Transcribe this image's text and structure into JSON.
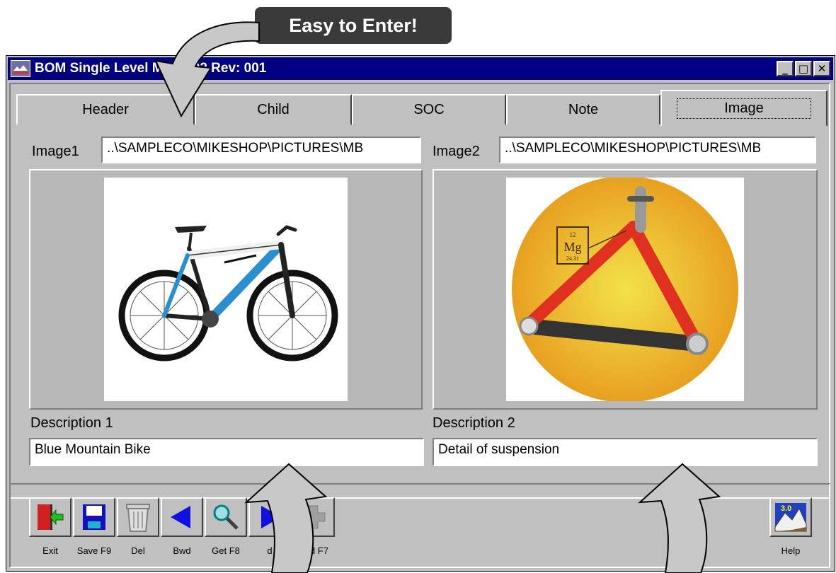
{
  "callout": {
    "text": "Easy to Enter!"
  },
  "window": {
    "title": "BOM Single Level   MBBA02  Rev: 001",
    "buttons": {
      "minimize": "_",
      "maximize": "□",
      "close": "✕"
    }
  },
  "tabs": [
    {
      "label": "Header"
    },
    {
      "label": "Child"
    },
    {
      "label": "SOC"
    },
    {
      "label": "Note"
    },
    {
      "label": "Image",
      "active": true
    }
  ],
  "image1": {
    "label": "Image1",
    "path": "..\\SAMPLECO\\MIKESHOP\\PICTURES\\MB",
    "description_label": "Description 1",
    "description": "Blue Mountain Bike"
  },
  "image2": {
    "label": "Image2",
    "path": "..\\SAMPLECO\\MIKESHOP\\PICTURES\\MB",
    "description_label": "Description 2",
    "description": "Detail of suspension",
    "element_symbol": "Mg",
    "element_number": "12",
    "element_weight": "24.31"
  },
  "toolbar": {
    "items": [
      {
        "label": "Exit",
        "icon": "exit-door-icon"
      },
      {
        "label": "Save F9",
        "icon": "floppy-disk-icon"
      },
      {
        "label": "Del",
        "icon": "trash-can-icon"
      },
      {
        "label": "Bwd",
        "icon": "left-arrow-icon"
      },
      {
        "label": "Get F8",
        "icon": "magnifier-icon"
      },
      {
        "label": "d",
        "icon": "forward-arrow-icon"
      },
      {
        "label": "Add F7",
        "icon": "plus-icon"
      }
    ],
    "help_label": "Help",
    "help_badge": "3.0"
  },
  "colors": {
    "titlebar": "#000080",
    "face": "#c0c0c0",
    "callout": "#3a3a3a",
    "arrow": "#c8c8c8"
  }
}
